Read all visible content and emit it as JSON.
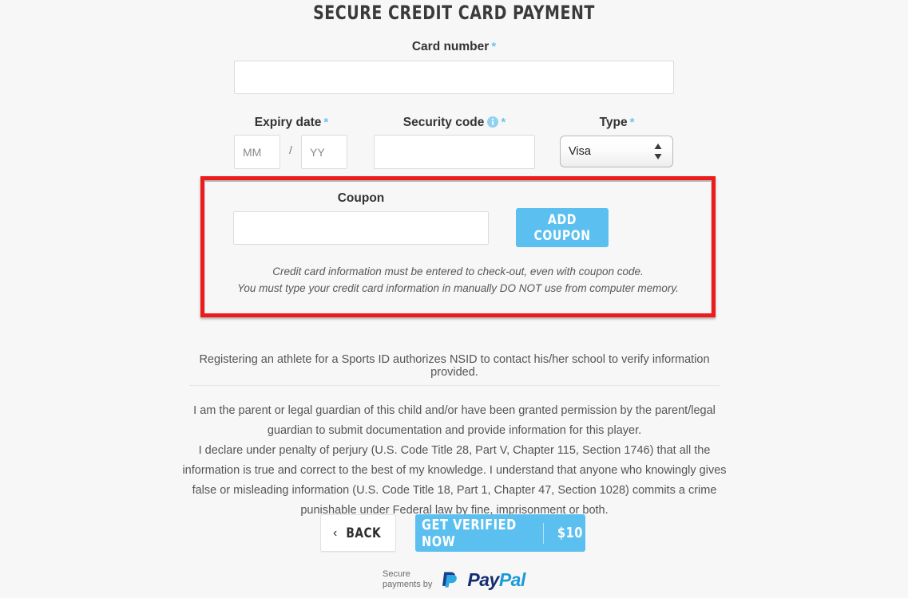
{
  "page": {
    "title": "SECURE CREDIT CARD PAYMENT",
    "background_color": "#f7f7f7",
    "accent_color": "#5bc0ef",
    "highlight_color": "#ed1c1c"
  },
  "form": {
    "card_number": {
      "label": "Card number",
      "required_marker": "*",
      "value": "",
      "placeholder": ""
    },
    "expiry": {
      "label": "Expiry date",
      "required_marker": "*",
      "month_placeholder": "MM",
      "month_value": "",
      "year_placeholder": "YY",
      "year_value": "",
      "separator": "/"
    },
    "security_code": {
      "label": "Security code",
      "required_marker": "*",
      "info_icon": "info-circle-icon",
      "value": "",
      "placeholder": ""
    },
    "type": {
      "label": "Type",
      "required_marker": "*",
      "selected": "Visa",
      "options": [
        "Visa"
      ]
    }
  },
  "coupon": {
    "label": "Coupon",
    "value": "",
    "placeholder": "",
    "button_label": "ADD COUPON",
    "note_line_1": "Credit card information must be entered to check-out, even with coupon code.",
    "note_line_2": "You must type your credit card information in manually DO NOT use from computer memory."
  },
  "consent": {
    "registering": "Registering an athlete for a Sports ID authorizes NSID to contact his/her school to verify information provided.",
    "guardian": "I am the parent or legal guardian of this child and/or have been granted permission by the parent/legal guardian to submit documentation and provide information for this player.",
    "perjury": "I declare under penalty of perjury (U.S. Code Title 28, Part V, Chapter 115, Section 1746) that all the information is true and correct to the best of my knowledge. I understand that anyone who knowingly gives false or misleading information (U.S. Code Title 18, Part 1, Chapter 47, Section 1028) commits a crime punishable under Federal law by fine, imprisonment or both."
  },
  "actions": {
    "back_label": "BACK",
    "back_icon": "chevron-left-icon",
    "verify_label": "GET VERIFIED NOW",
    "verify_price": "$10"
  },
  "footer": {
    "secure_text": "Secure\npayments by",
    "brand_part_1": "Pay",
    "brand_part_2": "Pal",
    "logo_icon": "paypal-logo-icon"
  }
}
